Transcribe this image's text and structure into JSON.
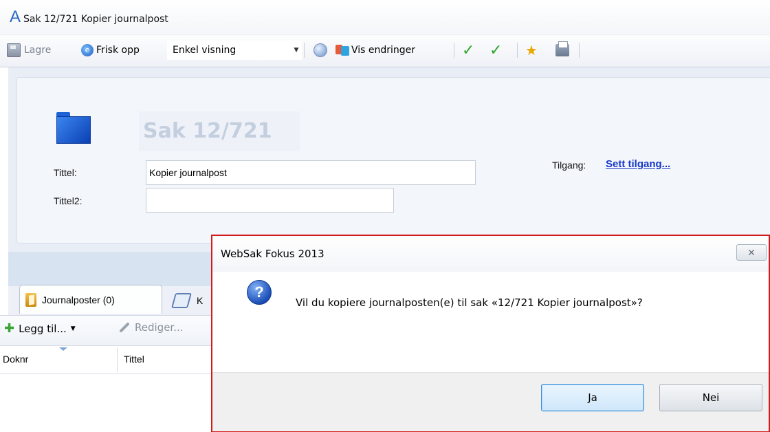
{
  "window": {
    "title": "Sak 12/721 Kopier journalpost",
    "logo": "A"
  },
  "toolbar": {
    "save_label": "Lagre",
    "refresh_label": "Frisk opp",
    "view_select_value": "Enkel visning",
    "changes_label": "Vis endringer",
    "icons": [
      "save-icon",
      "refresh-icon",
      "globe-icon",
      "diff-icon",
      "check-icon",
      "check-icon",
      "star-icon",
      "print-icon"
    ]
  },
  "case": {
    "title": "Sak 12/721",
    "title_label": "Tittel:",
    "title_value": "Kopier journalpost",
    "title2_label": "Tittel2:",
    "title2_value": "",
    "access_label": "Tilgang:",
    "access_link": "Sett tilgang..."
  },
  "tabs": {
    "journal_label": "Journalposter (0)",
    "second_label_partial": "K"
  },
  "subtoolbar": {
    "add_label": "Legg til...",
    "edit_label": "Rediger..."
  },
  "grid": {
    "columns": [
      "Doknr",
      "Tittel"
    ]
  },
  "dialog": {
    "title": "WebSak Fokus 2013",
    "message": "Vil du kopiere journalposten(e) til sak «12/721 Kopier journalpost»?",
    "yes_label": "Ja",
    "no_label": "Nei",
    "close_glyph": "✕",
    "icon_glyph": "?"
  },
  "colors": {
    "accent": "#2a68c6",
    "dialog_border": "#d21b1b",
    "link": "#1538c9"
  }
}
